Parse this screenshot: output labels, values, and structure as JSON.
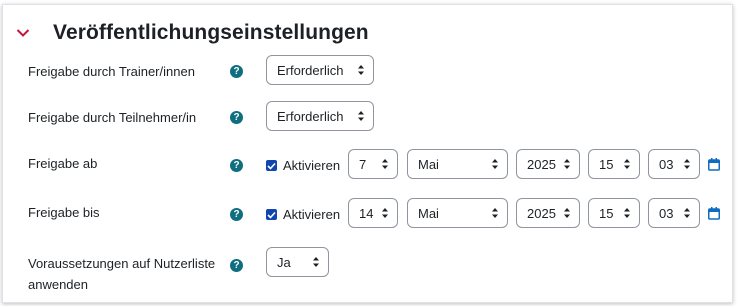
{
  "section": {
    "title": "Veröffentlichungseinstellungen"
  },
  "rows": {
    "trainer": {
      "label": "Freigabe durch Trainer/innen",
      "value": "Erforderlich"
    },
    "teilnehmer": {
      "label": "Freigabe durch Teilnehmer/in",
      "value": "Erforderlich"
    },
    "ab": {
      "label": "Freigabe ab",
      "checkbox_label": "Aktivieren",
      "checked": true,
      "day": "7",
      "month": "Mai",
      "year": "2025",
      "hour": "15",
      "minute": "03"
    },
    "bis": {
      "label": "Freigabe bis",
      "checkbox_label": "Aktivieren",
      "checked": true,
      "day": "14",
      "month": "Mai",
      "year": "2025",
      "hour": "15",
      "minute": "03"
    },
    "voraussetzungen": {
      "label_line1": "Voraussetzungen auf Nutzerliste",
      "label_line2": "anwenden",
      "value": "Ja"
    }
  },
  "help_icon_glyph": "?",
  "icons": {
    "collapse": "chevron-down-icon",
    "help": "question-circle-icon",
    "calendar": "calendar-icon",
    "select_arrow": "sort-arrows-icon"
  },
  "colors": {
    "accent_red": "#c0163f",
    "help_teal": "#0f6f7f",
    "checkbox_blue": "#0f47ad",
    "calendar_blue": "#0f6cbf"
  }
}
